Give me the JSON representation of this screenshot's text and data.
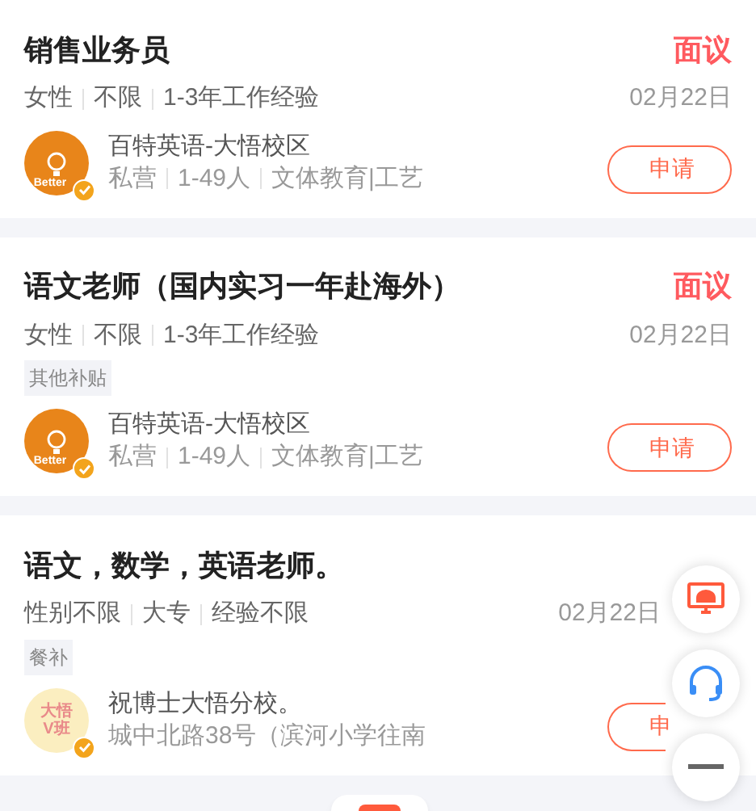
{
  "jobs": [
    {
      "title": "销售业务员",
      "salary": "面议",
      "requirements": [
        "女性",
        "不限",
        "1-3年工作经验"
      ],
      "date": "02月22日",
      "company": {
        "logo": {
          "kind": "bulb",
          "text": "Better"
        },
        "verified": true,
        "name": "百特英语-大悟校区",
        "info": [
          "私营",
          "1-49人",
          "文体教育|工艺"
        ]
      },
      "apply_button": "申请"
    },
    {
      "title": "语文老师（国内实习一年赴海外）",
      "salary": "面议",
      "requirements": [
        "女性",
        "不限",
        "1-3年工作经验"
      ],
      "date": "02月22日",
      "benefits": [
        "其他补贴"
      ],
      "company": {
        "logo": {
          "kind": "bulb",
          "text": "Better"
        },
        "verified": true,
        "name": "百特英语-大悟校区",
        "info": [
          "私营",
          "1-49人",
          "文体教育|工艺"
        ]
      },
      "apply_button": "申请"
    },
    {
      "title": "语文，数学，英语老师。",
      "requirements": [
        "性别不限",
        "大专",
        "经验不限"
      ],
      "date": "02月22日",
      "benefits": [
        "餐补"
      ],
      "company": {
        "logo": {
          "kind": "text",
          "text": "大悟V班"
        },
        "verified": true,
        "name": "祝博士大悟分校。",
        "info": [
          "城中北路38号（滨河小学往南"
        ]
      },
      "apply_button": "申"
    }
  ],
  "floating_buttons": [
    {
      "kind": "screen"
    },
    {
      "kind": "headset"
    },
    {
      "kind": "minus"
    }
  ]
}
